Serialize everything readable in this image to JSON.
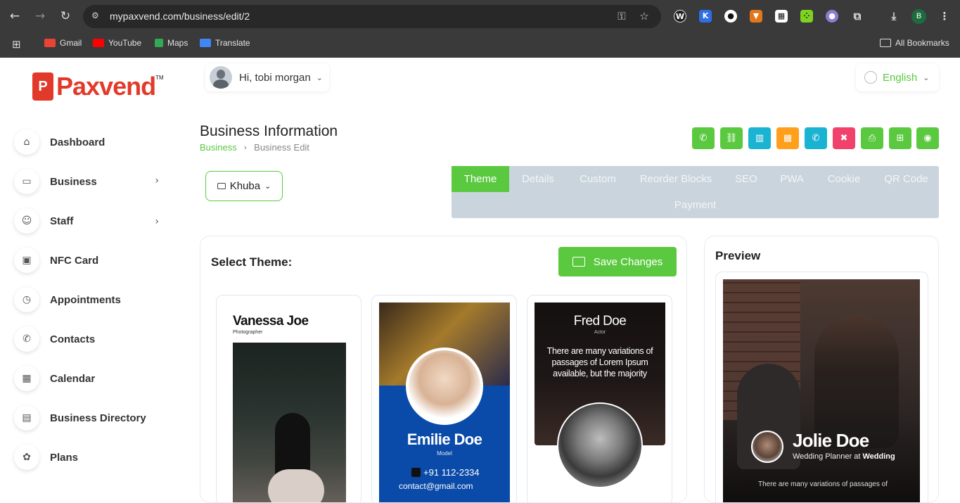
{
  "browser": {
    "url": "mypaxvend.com/business/edit/2",
    "profile_initial": "B",
    "bookmarks": [
      {
        "label": "Gmail",
        "color": "#ea4335"
      },
      {
        "label": "YouTube",
        "color": "#ff0000"
      },
      {
        "label": "Maps",
        "color": "#34a853"
      },
      {
        "label": "Translate",
        "color": "#4285f4"
      }
    ],
    "all_bookmarks": "All Bookmarks"
  },
  "brand": {
    "mark": "P",
    "name": "Paxvend",
    "tm": "TM",
    "color": "#e23a2a"
  },
  "sidebar": {
    "items": [
      {
        "label": "Dashboard"
      },
      {
        "label": "Business"
      },
      {
        "label": "Staff"
      },
      {
        "label": "NFC Card"
      },
      {
        "label": "Appointments"
      },
      {
        "label": "Contacts"
      },
      {
        "label": "Calendar"
      },
      {
        "label": "Business Directory"
      },
      {
        "label": "Plans"
      }
    ]
  },
  "header": {
    "user_greeting": "Hi, tobi morgan",
    "language": "English"
  },
  "page": {
    "title": "Business Information",
    "breadcrumb": {
      "parent": "Business",
      "current": "Business Edit"
    },
    "business_select": "Khuba"
  },
  "actions": [
    {
      "name": "whatsapp",
      "color": "#5bc940"
    },
    {
      "name": "link",
      "color": "#5bc940"
    },
    {
      "name": "analytics",
      "color": "#1ab3d2"
    },
    {
      "name": "appointment",
      "color": "#ff9f1c"
    },
    {
      "name": "call",
      "color": "#1ab3d2"
    },
    {
      "name": "delete",
      "color": "#f0426b"
    },
    {
      "name": "print",
      "color": "#5bc940"
    },
    {
      "name": "qr",
      "color": "#5bc940"
    },
    {
      "name": "view",
      "color": "#5bc940"
    }
  ],
  "tabs": [
    {
      "label": "Theme",
      "active": true
    },
    {
      "label": "Details"
    },
    {
      "label": "Custom"
    },
    {
      "label": "Reorder Blocks"
    },
    {
      "label": "SEO"
    },
    {
      "label": "PWA"
    },
    {
      "label": "Cookie"
    },
    {
      "label": "QR Code"
    },
    {
      "label": "Payment"
    }
  ],
  "theme_panel": {
    "label": "Select Theme:",
    "save_label": "Save Changes",
    "themes": [
      {
        "name": "Vanessa Joe",
        "role": "Photographer"
      },
      {
        "name": "Emilie Doe",
        "role": "Model",
        "phone": "+91 112-2334",
        "email": "contact@gmail.com"
      },
      {
        "name": "Fred Doe",
        "role": "Actor",
        "quote": "There are many variations of passages of Lorem Ipsum available, but the majority"
      }
    ]
  },
  "preview": {
    "title": "Preview",
    "name": "Jolie Doe",
    "subtitle_prefix": "Wedding Planner at",
    "subtitle_company": "Wedding",
    "description": "There are many variations of passages of"
  }
}
